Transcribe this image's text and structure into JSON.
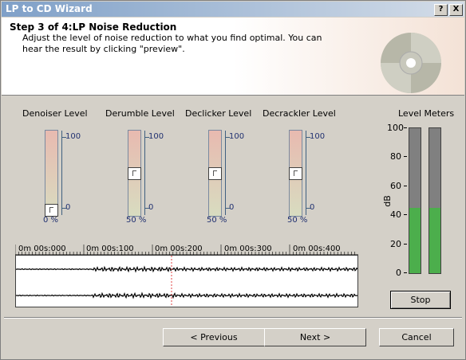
{
  "window": {
    "title": "LP to CD Wizard",
    "help_btn": "?",
    "close_btn": "X"
  },
  "header": {
    "step_title": "Step 3 of 4:LP Noise Reduction",
    "step_desc": "Adjust the level of noise reduction to what you find optimal. You can hear the result by clicking \"preview\"."
  },
  "sliders": [
    {
      "label": "Denoiser Level",
      "value": "0 %",
      "level": 0,
      "max": "100",
      "min": "0"
    },
    {
      "label": "Derumble Level",
      "value": "50 %",
      "level": 50,
      "max": "100",
      "min": "0"
    },
    {
      "label": "Declicker Level",
      "value": "50 %",
      "level": 50,
      "max": "100",
      "min": "0"
    },
    {
      "label": "Decrackler Level",
      "value": "50 %",
      "level": 50,
      "max": "100",
      "min": "0"
    }
  ],
  "timeline": {
    "labels": [
      "0m 00s:000",
      "0m 00s:100",
      "0m 00s:200",
      "0m 00s:300",
      "0m 00s:400"
    ]
  },
  "meters": {
    "title": "Level Meters",
    "unit": "dB",
    "scale": [
      "100",
      "80",
      "60",
      "40",
      "20",
      "0"
    ],
    "levels": [
      45,
      45
    ],
    "stop_label": "Stop"
  },
  "buttons": {
    "previous": "< Previous",
    "next": "Next >",
    "cancel": "Cancel"
  }
}
